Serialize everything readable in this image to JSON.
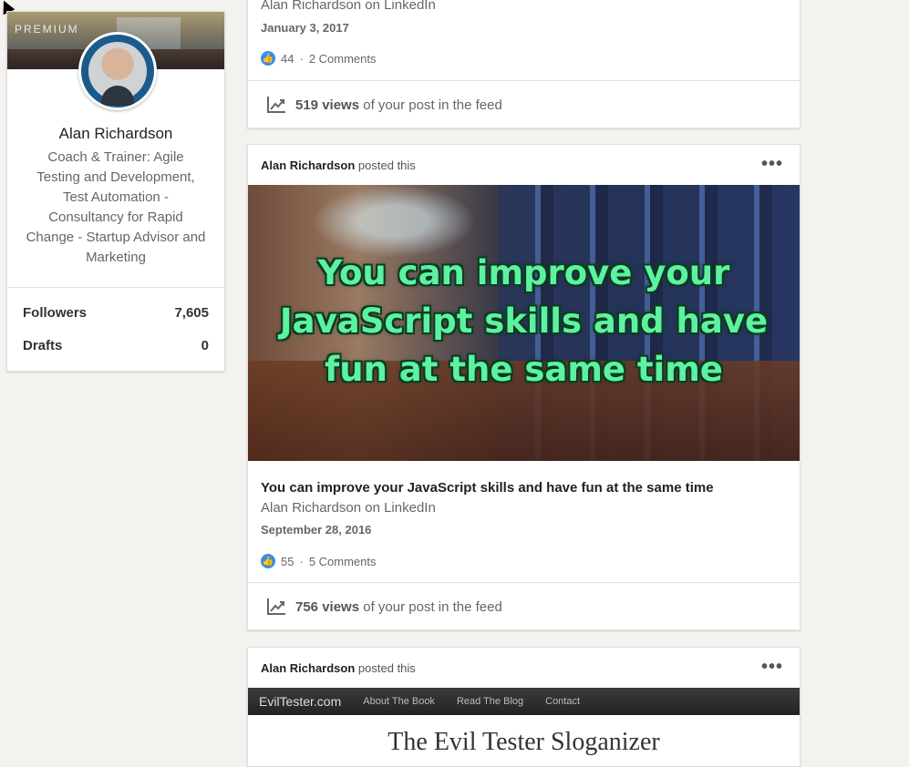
{
  "profile": {
    "premium_label": "PREMIUM",
    "name": "Alan Richardson",
    "headline": "Coach & Trainer: Agile Testing and Development, Test Automation - Consultancy for Rapid Change - Startup Advisor and Marketing",
    "stats": [
      {
        "label": "Followers",
        "value": "7,605"
      },
      {
        "label": "Drafts",
        "value": "0"
      }
    ]
  },
  "posts": [
    {
      "subtitle": "Alan Richardson on LinkedIn",
      "date": "January 3, 2017",
      "likes": "44",
      "comments": "2 Comments",
      "views_count": "519 views",
      "views_suffix": "of your post in the feed"
    },
    {
      "author": "Alan Richardson",
      "posted_suffix": "posted this",
      "image_text": "You can improve your JavaScript skills and have fun at the same time",
      "title": "You can improve your JavaScript skills and have fun at the same time",
      "subtitle": "Alan Richardson on LinkedIn",
      "date": "September 28, 2016",
      "likes": "55",
      "comments": "5 Comments",
      "views_count": "756 views",
      "views_suffix": "of your post in the feed"
    },
    {
      "author": "Alan Richardson",
      "posted_suffix": "posted this",
      "site_brand": "EvilTester.com",
      "site_nav": [
        "About The Book",
        "Read The Blog",
        "Contact"
      ],
      "site_title": "The Evil Tester Sloganizer"
    }
  ],
  "ui": {
    "more_glyph": "•••",
    "dot_separator": "·",
    "accent_color": "#378fe9"
  }
}
